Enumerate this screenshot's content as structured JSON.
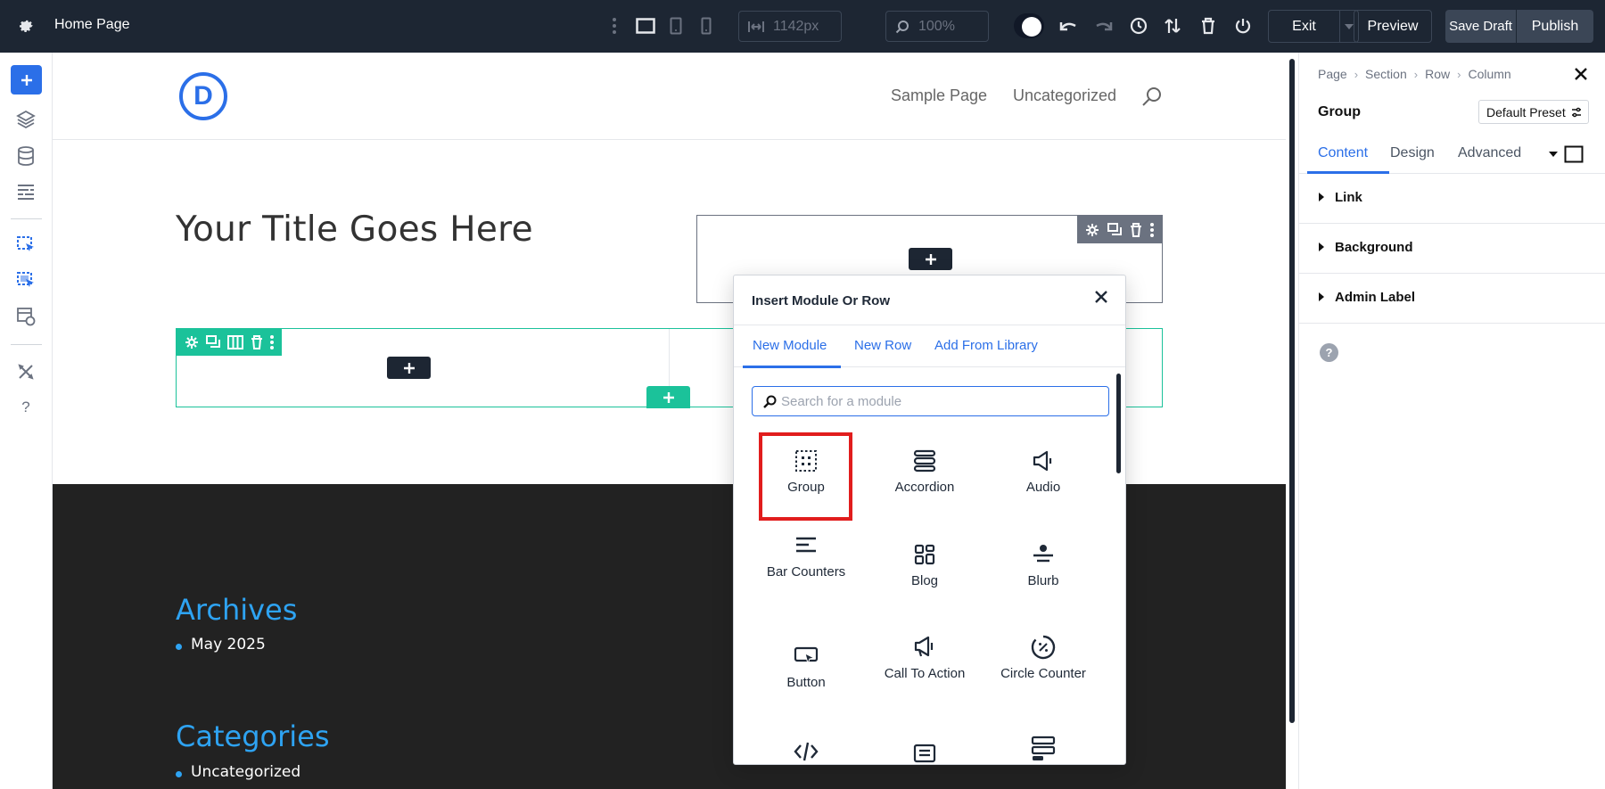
{
  "topbar": {
    "page_name": "Home Page",
    "width_value": "1142px",
    "zoom_value": "100%",
    "exit_label": "Exit",
    "preview_label": "Preview",
    "save_draft_label": "Save Draft",
    "publish_label": "Publish"
  },
  "site": {
    "logo_letter": "D",
    "nav": [
      "Sample Page",
      "Uncategorized"
    ],
    "hero_title": "Your Title Goes Here",
    "footer": {
      "archives_title": "Archives",
      "archives_item": "May 2025",
      "categories_title": "Categories",
      "categories_item": "Uncategorized"
    }
  },
  "popup": {
    "title": "Insert Module Or Row",
    "tabs": [
      "New Module",
      "New Row",
      "Add From Library"
    ],
    "search_placeholder": "Search for a module",
    "modules": [
      "Group",
      "Accordion",
      "Audio",
      "Bar Counters",
      "Blog",
      "Blurb",
      "Button",
      "Call To Action",
      "Circle Counter"
    ]
  },
  "panel": {
    "breadcrumb": [
      "Page",
      "Section",
      "Row",
      "Column"
    ],
    "title": "Group",
    "preset_label": "Default Preset",
    "tabs": [
      "Content",
      "Design",
      "Advanced"
    ],
    "sections": [
      "Link",
      "Background",
      "Admin Label"
    ],
    "help_label": "?"
  },
  "colors": {
    "toolbar_bg": "#1d2633",
    "accent_blue": "#2b6fe8",
    "row_green": "#1bc29a",
    "highlight_red": "#e11d1d",
    "footer_bg": "#222222",
    "footer_link": "#2ea3f2"
  }
}
